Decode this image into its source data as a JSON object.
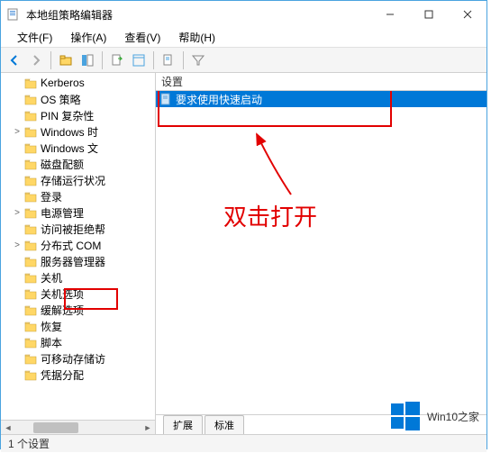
{
  "window": {
    "title": "本地组策略编辑器"
  },
  "menu": {
    "file": "文件(F)",
    "action": "操作(A)",
    "view": "查看(V)",
    "help": "帮助(H)"
  },
  "tree": {
    "items": [
      {
        "label": "Kerberos",
        "exp": ""
      },
      {
        "label": "OS 策略",
        "exp": ""
      },
      {
        "label": "PIN 复杂性",
        "exp": ""
      },
      {
        "label": "Windows 时",
        "exp": ">"
      },
      {
        "label": "Windows 文",
        "exp": ""
      },
      {
        "label": "磁盘配额",
        "exp": ""
      },
      {
        "label": "存储运行状况",
        "exp": ""
      },
      {
        "label": "登录",
        "exp": ""
      },
      {
        "label": "电源管理",
        "exp": ">"
      },
      {
        "label": "访问被拒绝帮",
        "exp": ""
      },
      {
        "label": "分布式 COM",
        "exp": ">"
      },
      {
        "label": "服务器管理器",
        "exp": ""
      },
      {
        "label": "关机",
        "exp": "",
        "selected": true
      },
      {
        "label": "关机选项",
        "exp": ""
      },
      {
        "label": "缓解选项",
        "exp": ""
      },
      {
        "label": "恢复",
        "exp": ""
      },
      {
        "label": "脚本",
        "exp": ""
      },
      {
        "label": "可移动存储访",
        "exp": ""
      },
      {
        "label": "凭据分配",
        "exp": ""
      }
    ]
  },
  "list": {
    "header": "设置",
    "item": "要求使用快速启动"
  },
  "tabs": {
    "extended": "扩展",
    "standard": "标准"
  },
  "statusbar": {
    "text": "1 个设置"
  },
  "annotation": {
    "text": "双击打开"
  },
  "watermark": {
    "text": "Win10之家"
  }
}
